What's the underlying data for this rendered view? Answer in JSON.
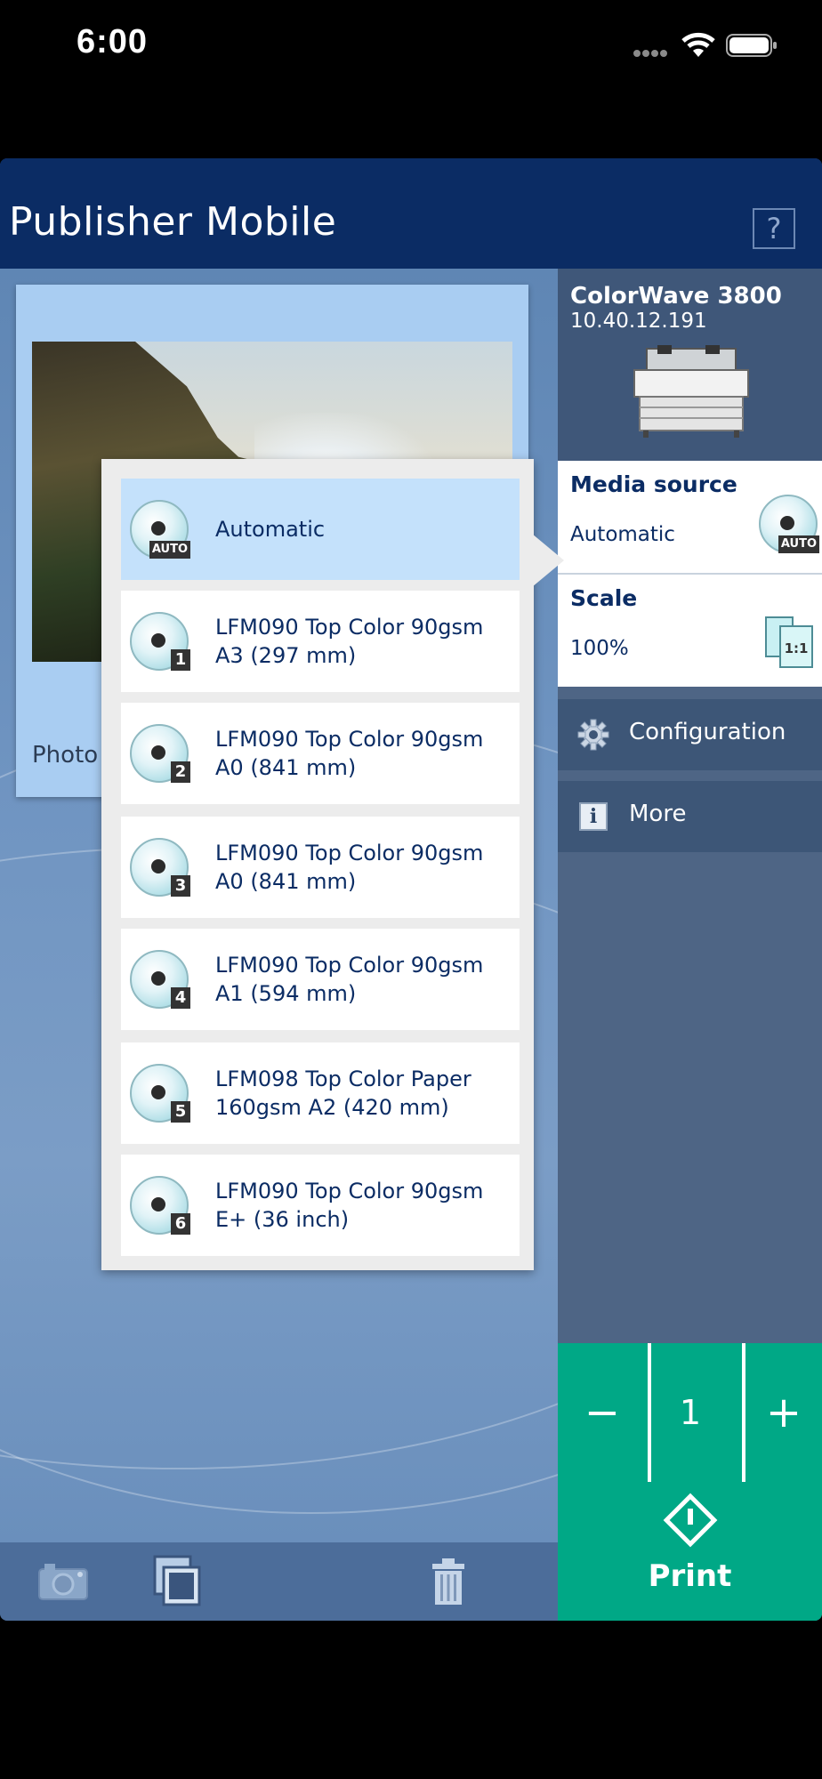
{
  "status_bar": {
    "time": "6:00",
    "wifi_icon": "wifi-icon",
    "battery_icon": "battery-icon"
  },
  "header": {
    "title": "Publisher Mobile",
    "help_label": "?"
  },
  "document": {
    "label": "Photo"
  },
  "printer": {
    "name": "ColorWave 3800",
    "ip": "10.40.12.191"
  },
  "settings": {
    "media_source": {
      "title": "Media source",
      "value": "Automatic",
      "badge": "AUTO"
    },
    "scale": {
      "title": "Scale",
      "value": "100%",
      "badge": "1:1"
    }
  },
  "nav": {
    "configuration": "Configuration",
    "more": "More"
  },
  "copies": {
    "minus": "−",
    "value": "1",
    "plus": "+"
  },
  "print": {
    "label": "Print"
  },
  "media_options": [
    {
      "label": "Automatic",
      "badge": "AUTO",
      "selected": true
    },
    {
      "label": "LFM090 Top Color 90gsm A3 (297 mm)",
      "badge": "1"
    },
    {
      "label": "LFM090 Top Color 90gsm A0 (841 mm)",
      "badge": "2"
    },
    {
      "label": "LFM090 Top Color 90gsm A0 (841 mm)",
      "badge": "3"
    },
    {
      "label": "LFM090 Top Color 90gsm A1 (594 mm)",
      "badge": "4"
    },
    {
      "label": "LFM098 Top Color Paper 160gsm A2 (420 mm)",
      "badge": "5"
    },
    {
      "label": "LFM090 Top Color 90gsm E+ (36 inch)",
      "badge": "6"
    }
  ],
  "colors": {
    "header": "#0b2c64",
    "accent_green": "#00a886",
    "selected_row": "#c4e1fb"
  }
}
